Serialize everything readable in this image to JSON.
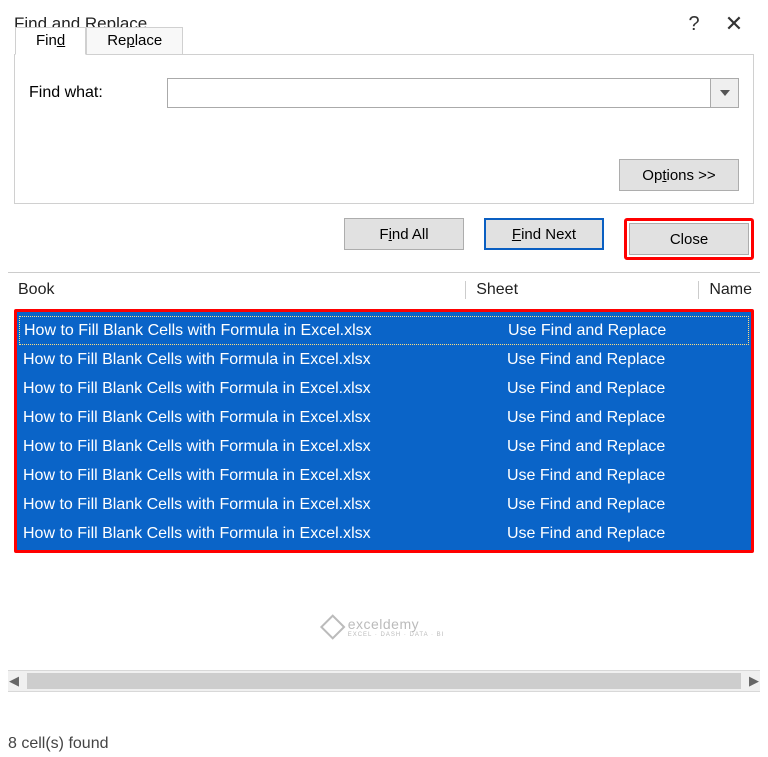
{
  "title": "Find and Replace",
  "tabs": {
    "find": "Find",
    "replace": "Replace"
  },
  "find_what_label": "Find what:",
  "find_what_value": "",
  "options_label": "Options >>",
  "buttons": {
    "find_all": "Find All",
    "find_next": "Find Next",
    "close": "Close"
  },
  "columns": {
    "book": "Book",
    "sheet": "Sheet",
    "name": "Name"
  },
  "results": [
    {
      "book": "How to Fill Blank Cells with Formula in Excel.xlsx",
      "sheet": "Use Find and Replace"
    },
    {
      "book": "How to Fill Blank Cells with Formula in Excel.xlsx",
      "sheet": "Use Find and Replace"
    },
    {
      "book": "How to Fill Blank Cells with Formula in Excel.xlsx",
      "sheet": "Use Find and Replace"
    },
    {
      "book": "How to Fill Blank Cells with Formula in Excel.xlsx",
      "sheet": "Use Find and Replace"
    },
    {
      "book": "How to Fill Blank Cells with Formula in Excel.xlsx",
      "sheet": "Use Find and Replace"
    },
    {
      "book": "How to Fill Blank Cells with Formula in Excel.xlsx",
      "sheet": "Use Find and Replace"
    },
    {
      "book": "How to Fill Blank Cells with Formula in Excel.xlsx",
      "sheet": "Use Find and Replace"
    },
    {
      "book": "How to Fill Blank Cells with Formula in Excel.xlsx",
      "sheet": "Use Find and Replace"
    }
  ],
  "status": "8 cell(s) found",
  "watermark": {
    "text": "exceldemy",
    "sub": "EXCEL · DASH · DATA · BI"
  }
}
